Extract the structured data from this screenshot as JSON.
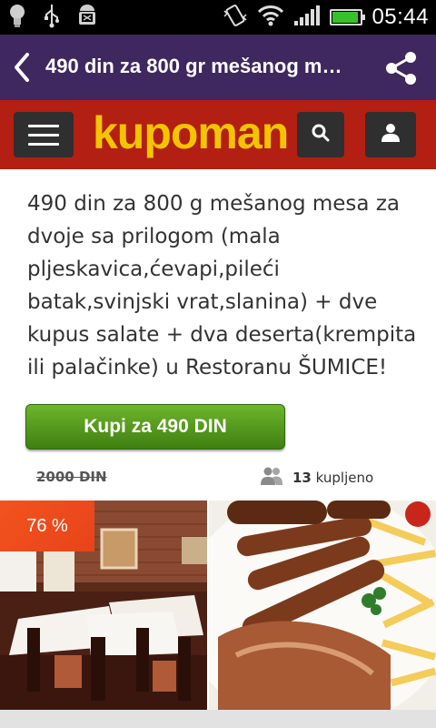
{
  "status_bar": {
    "time": "05:44",
    "icons": [
      "lightbulb-icon",
      "usb-icon",
      "android-debug-icon",
      "vibrate-icon",
      "wifi-icon",
      "signal-icon",
      "battery-icon"
    ]
  },
  "app_bar": {
    "title": "490 din za 800 gr mešanog mes…",
    "back_icon": "chevron-left-icon",
    "share_icon": "share-icon"
  },
  "header": {
    "logo_text": "kupoman",
    "menu_icon": "hamburger-icon",
    "search_icon": "search-icon",
    "user_icon": "user-icon",
    "background_color": "#b31f12",
    "logo_color": "#f5c400"
  },
  "deal": {
    "description": "490 din za 800 g mešanog mesa za dvoje sa prilogom (mala pljeskavica,ćevapi,pileći batak,svinjski vrat,slanina) + dve kupus salate + dva deserta(krempita ili palačinke) u Restoranu ŠUMICE!",
    "buy_button_label": "Kupi za 490 DIN",
    "old_price": "2000 DIN",
    "bought_count": "13",
    "bought_label": "kupljeno",
    "discount_badge": "76 %",
    "buy_button_color": "#4f9a1d",
    "discount_color": "#f2531e"
  }
}
